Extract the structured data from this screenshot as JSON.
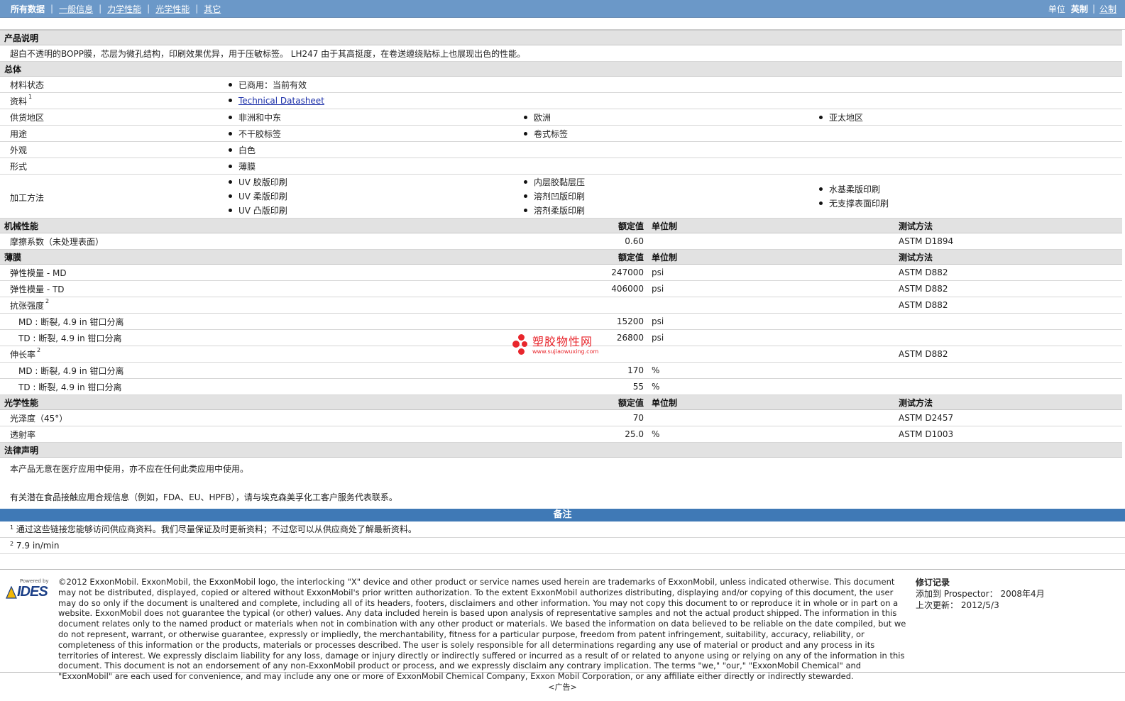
{
  "nav": {
    "tabs": [
      "所有数据",
      "一般信息",
      "力学性能",
      "光学性能",
      "其它"
    ],
    "unit_label": "单位",
    "units": [
      "英制",
      "公制"
    ]
  },
  "product_desc": {
    "title": "产品说明",
    "text": "超白不透明的BOPP膜，芯层为微孔结构，印刷效果优异，用于压敏标签。 LH247 由于其高挺度，在卷送缠绕贴标上也展现出色的性能。"
  },
  "general": {
    "title": "总体",
    "rows": [
      {
        "label": "材料状态",
        "items": [
          [
            "已商用：当前有效"
          ],
          [],
          []
        ]
      },
      {
        "label": "资料",
        "sup": "1",
        "items": [
          [
            "Technical Datasheet"
          ],
          [],
          []
        ]
      },
      {
        "label": "供货地区",
        "items": [
          [
            "非洲和中东"
          ],
          [
            "欧洲"
          ],
          [
            "亚太地区"
          ]
        ]
      },
      {
        "label": "用途",
        "items": [
          [
            "不干胶标签"
          ],
          [
            "卷式标签"
          ],
          []
        ]
      },
      {
        "label": "外观",
        "items": [
          [
            "白色"
          ],
          [],
          []
        ]
      },
      {
        "label": "形式",
        "items": [
          [
            "薄膜"
          ],
          [],
          []
        ]
      },
      {
        "label": "加工方法",
        "items": [
          [
            "UV 胶版印刷",
            "UV 柔版印刷",
            "UV 凸版印刷"
          ],
          [
            "内层胶黏层压",
            "溶剂凹版印刷",
            "溶剂柔版印刷"
          ],
          [
            "水基柔版印刷",
            "无支撑表面印刷"
          ]
        ]
      }
    ]
  },
  "col_headers": {
    "nominal": "额定值",
    "unit": "单位制",
    "method": "测试方法"
  },
  "mechanical": {
    "title": "机械性能",
    "rows": [
      {
        "label": "摩擦系数（未处理表面）",
        "value": "0.60",
        "unit": "",
        "method": "ASTM D1894"
      }
    ]
  },
  "film": {
    "title": "薄膜",
    "rows": [
      {
        "label": "弹性模量  - MD",
        "value": "247000",
        "unit": "psi",
        "method": "ASTM D882",
        "sub": false
      },
      {
        "label": "弹性模量  - TD",
        "value": "406000",
        "unit": "psi",
        "method": "ASTM D882",
        "sub": false
      },
      {
        "label": "抗张强度",
        "sup": "2",
        "value": "",
        "unit": "",
        "method": "ASTM D882",
        "sub": false
      },
      {
        "label": "MD : 断裂, 4.9 in 钳口分离",
        "value": "15200",
        "unit": "psi",
        "method": "",
        "sub": true
      },
      {
        "label": "TD : 断裂, 4.9 in 钳口分离",
        "value": "26800",
        "unit": "psi",
        "method": "",
        "sub": true
      },
      {
        "label": "伸长率",
        "sup": "2",
        "value": "",
        "unit": "",
        "method": "ASTM D882",
        "sub": false
      },
      {
        "label": "MD : 断裂, 4.9 in 钳口分离",
        "value": "170",
        "unit": "%",
        "method": "",
        "sub": true
      },
      {
        "label": "TD : 断裂, 4.9 in 钳口分离",
        "value": "55",
        "unit": "%",
        "method": "",
        "sub": true
      }
    ]
  },
  "optical": {
    "title": "光学性能",
    "rows": [
      {
        "label": "光泽度（45°）",
        "value": "70",
        "unit": "",
        "method": "ASTM D2457"
      },
      {
        "label": "透射率",
        "value": "25.0",
        "unit": "%",
        "method": "ASTM D1003"
      }
    ]
  },
  "legal": {
    "title": "法律声明",
    "line1": "本产品无意在医疗应用中使用，亦不应在任何此类应用中使用。",
    "line2": "有关潜在食品接触应用合规信息（例如，FDA、EU、HPFB），请与埃克森美孚化工客户服务代表联系。"
  },
  "notes": {
    "title": "备注",
    "items": [
      {
        "sup": "1",
        "text": "通过这些链接您能够访问供应商资料。我们尽量保证及时更新资料；不过您可以从供应商处了解最新资料。"
      },
      {
        "sup": "2",
        "text": "7.9 in/min"
      }
    ]
  },
  "footer": {
    "powered_by": "Powered by",
    "ides": "IDES",
    "copyright": "©2012 ExxonMobil. ExxonMobil, the ExxonMobil logo, the interlocking \"X\" device and other product or service names used herein are trademarks of ExxonMobil, unless indicated otherwise. This document may not be distributed, displayed, copied or altered without ExxonMobil's prior written authorization. To the extent ExxonMobil authorizes distributing, displaying and/or copying of this document, the user may do so only if the document is unaltered and complete, including all of its headers, footers, disclaimers and other information. You may not copy this document to or reproduce it in whole or in part on a website. ExxonMobil does not guarantee the typical (or other) values. Any data included herein is based upon analysis of representative samples and not the actual product shipped. The information in this document relates only to the named product or materials when not in combination with any other product or materials. We based the information on data believed to be reliable on the date compiled, but we do not represent, warrant, or otherwise guarantee, expressly or impliedly, the merchantability, fitness for a particular purpose, freedom from patent infringement, suitability, accuracy, reliability, or completeness of this information or the products, materials or processes described. The user is solely responsible for all determinations regarding any use of material or product and any process in its territories of interest. We expressly disclaim liability for any loss, damage or injury directly or indirectly suffered or incurred as a result of or related to anyone using or relying on any of the information in this document. This document is not an endorsement of any non-ExxonMobil product or process, and we expressly disclaim any contrary implication. The terms \"we,\" \"our,\" \"ExxonMobil Chemical\" and \"ExxonMobil\" are each used for convenience, and may include any one or more of ExxonMobil Chemical Company, Exxon Mobil Corporation, or any affiliate either directly or indirectly stewarded.",
    "revision_title": "修订记录",
    "added_label": "添加到  Prospector：",
    "added_value": "2008年4月",
    "updated_label": "上次更新：",
    "updated_value": "2012/5/3",
    "ad": "<广告>"
  },
  "watermark": {
    "main": "塑胶物性网",
    "sub": "www.sujiaowuxing.com",
    "color": "#e8262c"
  }
}
